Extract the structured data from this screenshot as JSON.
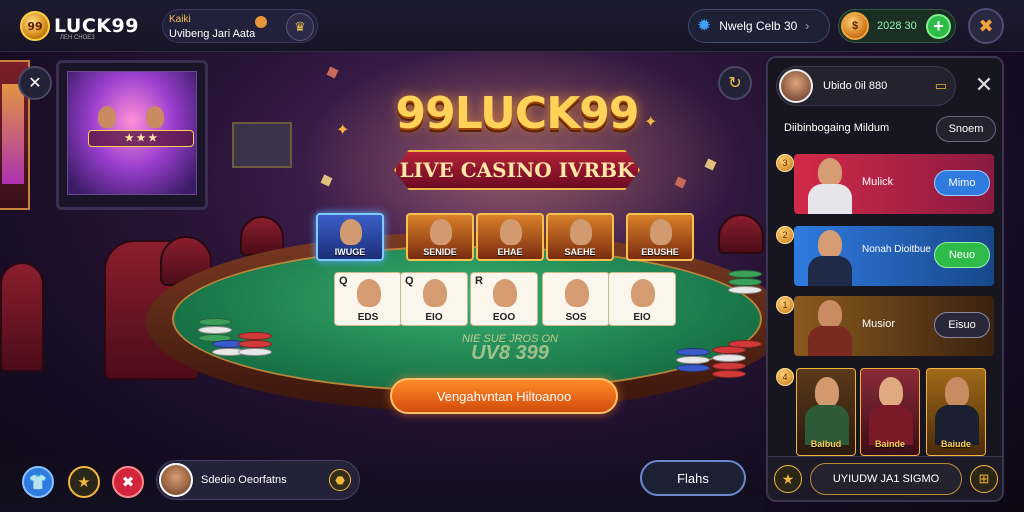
{
  "header": {
    "logo_text": "LUCK99",
    "logo_coin": "99",
    "logo_sub": "ЛЕН СНОЕЗ",
    "profile_title": "Kaiki",
    "profile_subtitle": "Uvibeng Jari Aata",
    "gems": {
      "label": "Nwelg Celb 30",
      "icon": "gem-icon"
    },
    "coins": {
      "value": "2028 30",
      "icon": "coin-icon"
    },
    "add_label": "+",
    "tools_icon": "tools-icon"
  },
  "game": {
    "title": "99LUCK99",
    "subtitle": "LIVE CASINO IVRBK",
    "seats": [
      {
        "label": "IWUGE",
        "selected": true
      },
      {
        "label": "SENIDE",
        "selected": false
      },
      {
        "label": "EHAE",
        "selected": false
      },
      {
        "label": "SAEHE",
        "selected": false
      },
      {
        "label": "EBUSHE",
        "selected": false
      }
    ],
    "cards": [
      {
        "rank": "Q",
        "value": "EDS"
      },
      {
        "rank": "Q",
        "value": "EIO"
      },
      {
        "rank": "R",
        "value": "EOO"
      },
      {
        "rank": "",
        "value": "SOS"
      },
      {
        "rank": "",
        "value": "EIO"
      }
    ],
    "pot_label": "NIE SUE JROS ON",
    "pot_value": "UV8 399",
    "play_button": "Vengahvntan Hiltoanoo"
  },
  "bottom": {
    "player_name": "Sdedio Oeorfatns",
    "menu_button": "Flahs",
    "colors": {
      "blue": "#2f7be0",
      "gold": "#f2b640",
      "red": "#d0253a"
    }
  },
  "panel": {
    "user_name": "Ubido 0il 880",
    "subtitle": "Diibinbogaing Mildum",
    "subtitle_button": "Snoem",
    "rooms": [
      {
        "name": "Mulick",
        "button": "Mimo",
        "badge": "3"
      },
      {
        "name": "Nonah Dioitbue",
        "button": "Neuo",
        "badge": "2"
      },
      {
        "name": "Musior",
        "button": "Eisuo",
        "badge": "1"
      }
    ],
    "badge_four": "4",
    "tiles": [
      "Baibud",
      "Bainde",
      "Baiude"
    ],
    "footer_button": "UYIUDW JA1 SIGMO"
  }
}
